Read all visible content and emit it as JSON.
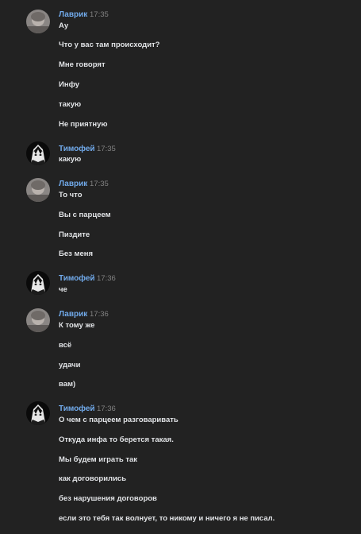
{
  "groups": [
    {
      "author": "Лаврик",
      "time": "17:35",
      "avatar": "lavrik-avatar",
      "messages": [
        "Ау",
        "Что у вас там происходит?",
        "Мне говорят",
        "Инфу",
        "такую",
        "Не приятную"
      ]
    },
    {
      "author": "Тимофей",
      "time": "17:35",
      "avatar": "timofey-avatar",
      "messages": [
        "какую"
      ]
    },
    {
      "author": "Лаврик",
      "time": "17:35",
      "avatar": "lavrik-avatar",
      "messages": [
        "То что",
        "Вы с парцеем",
        "Пиздите",
        "Без меня"
      ]
    },
    {
      "author": "Тимофей",
      "time": "17:36",
      "avatar": "timofey-avatar",
      "messages": [
        "че"
      ]
    },
    {
      "author": "Лаврик",
      "time": "17:36",
      "avatar": "lavrik-avatar",
      "messages": [
        "К тому же",
        "всё",
        "удачи",
        "вам)"
      ]
    },
    {
      "author": "Тимофей",
      "time": "17:36",
      "avatar": "timofey-avatar",
      "messages": [
        "О чем с парцеем разговаривать",
        "Откуда инфа то берется такая.",
        "Мы будем играть так",
        "как договорились",
        "без нарушения договоров",
        "если это тебя так волнует, то никому и ничего я не писал."
      ]
    }
  ],
  "colors": {
    "background": "#222222",
    "author_name": "#71aaeb",
    "timestamp": "#828282",
    "message_text": "#e1e3e6"
  }
}
